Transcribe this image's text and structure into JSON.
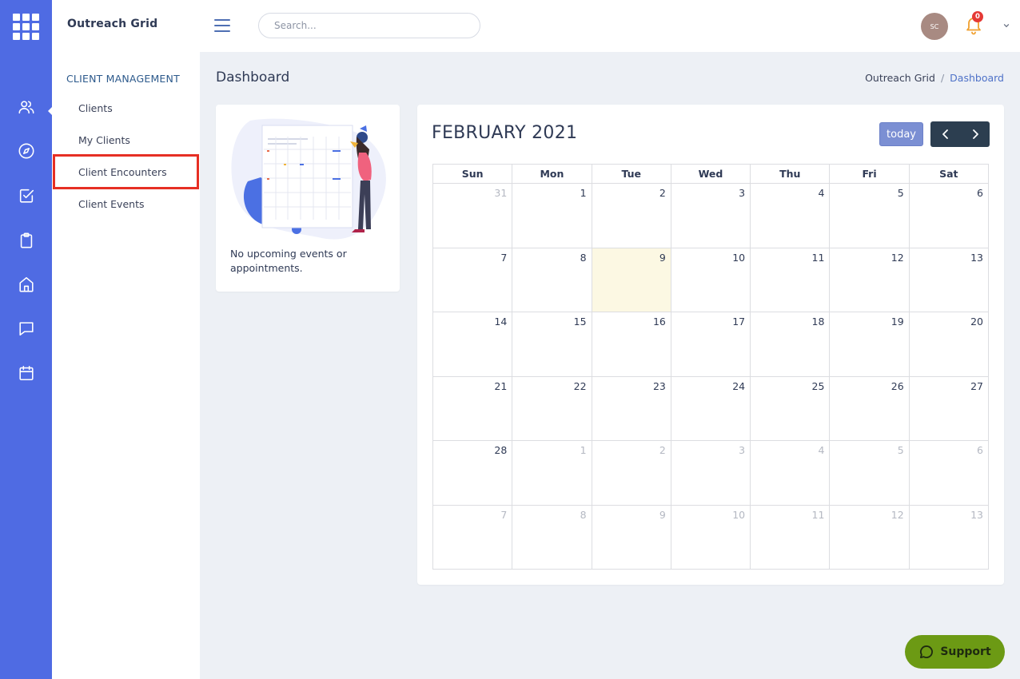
{
  "brand": "Outreach Grid",
  "sidebar": {
    "section_title": "CLIENT MANAGEMENT",
    "items": [
      {
        "label": "Clients"
      },
      {
        "label": "My Clients"
      },
      {
        "label": "Client Encounters"
      },
      {
        "label": "Client Events"
      }
    ]
  },
  "rail_icons": [
    "users-icon",
    "compass-icon",
    "checkbox-icon",
    "clipboard-icon",
    "home-icon",
    "chat-icon",
    "calendar-icon"
  ],
  "topbar": {
    "search_placeholder": "Search...",
    "avatar_initials": "SC",
    "notification_count": "0"
  },
  "page": {
    "title": "Dashboard",
    "breadcrumb": [
      "Outreach Grid",
      "Dashboard"
    ]
  },
  "events_card": {
    "message": "No upcoming events or appointments."
  },
  "calendar": {
    "title": "FEBRUARY 2021",
    "today_label": "today",
    "weekdays": [
      "Sun",
      "Mon",
      "Tue",
      "Wed",
      "Thu",
      "Fri",
      "Sat"
    ],
    "weeks": [
      [
        {
          "d": "31",
          "o": true
        },
        {
          "d": "1"
        },
        {
          "d": "2"
        },
        {
          "d": "3"
        },
        {
          "d": "4"
        },
        {
          "d": "5"
        },
        {
          "d": "6"
        }
      ],
      [
        {
          "d": "7"
        },
        {
          "d": "8"
        },
        {
          "d": "9",
          "t": true
        },
        {
          "d": "10"
        },
        {
          "d": "11"
        },
        {
          "d": "12"
        },
        {
          "d": "13"
        }
      ],
      [
        {
          "d": "14"
        },
        {
          "d": "15"
        },
        {
          "d": "16"
        },
        {
          "d": "17"
        },
        {
          "d": "18"
        },
        {
          "d": "19"
        },
        {
          "d": "20"
        }
      ],
      [
        {
          "d": "21"
        },
        {
          "d": "22"
        },
        {
          "d": "23"
        },
        {
          "d": "24"
        },
        {
          "d": "25"
        },
        {
          "d": "26"
        },
        {
          "d": "27"
        }
      ],
      [
        {
          "d": "28"
        },
        {
          "d": "1",
          "o": true
        },
        {
          "d": "2",
          "o": true
        },
        {
          "d": "3",
          "o": true
        },
        {
          "d": "4",
          "o": true
        },
        {
          "d": "5",
          "o": true
        },
        {
          "d": "6",
          "o": true
        }
      ],
      [
        {
          "d": "7",
          "o": true
        },
        {
          "d": "8",
          "o": true
        },
        {
          "d": "9",
          "o": true
        },
        {
          "d": "10",
          "o": true
        },
        {
          "d": "11",
          "o": true
        },
        {
          "d": "12",
          "o": true
        },
        {
          "d": "13",
          "o": true
        }
      ]
    ]
  },
  "support_label": "Support",
  "colors": {
    "rail": "#4f6be3",
    "accent": "#4f72c8",
    "selected_outline": "#e62f24",
    "support": "#6c9a14",
    "today_bg": "#fcf8e3"
  }
}
